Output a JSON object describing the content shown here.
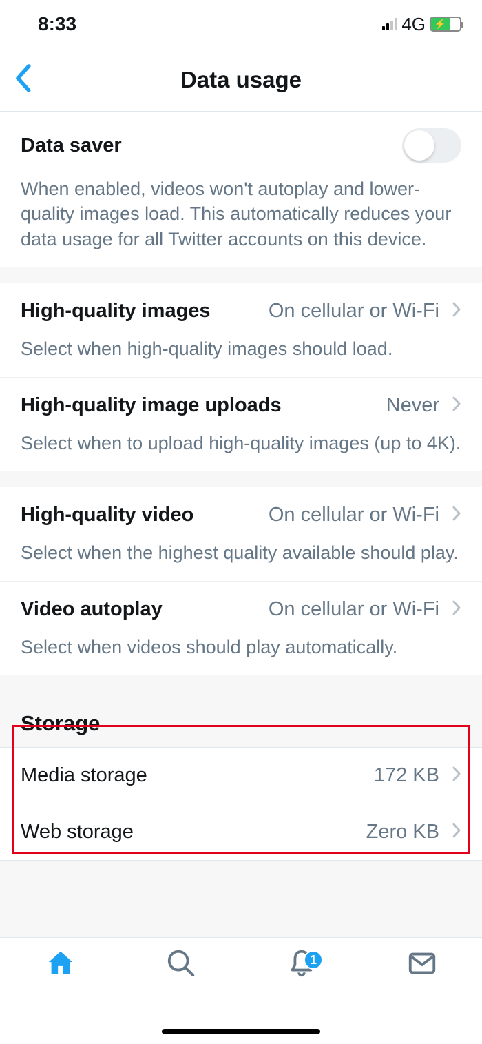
{
  "status": {
    "time": "8:33",
    "network": "4G"
  },
  "header": {
    "title": "Data usage"
  },
  "dataSaver": {
    "title": "Data saver",
    "desc": "When enabled, videos won't autoplay and lower-quality images load. This automatically reduces your data usage for all Twitter accounts on this device."
  },
  "settings": [
    {
      "title": "High-quality images",
      "value": "On cellular or Wi-Fi",
      "desc": "Select when high-quality images should load."
    },
    {
      "title": "High-quality image uploads",
      "value": "Never",
      "desc": "Select when to upload high-quality images (up to 4K)."
    }
  ],
  "video": [
    {
      "title": "High-quality video",
      "value": "On cellular or Wi-Fi",
      "desc": "Select when the highest quality available should play."
    },
    {
      "title": "Video autoplay",
      "value": "On cellular or Wi-Fi",
      "desc": "Select when videos should play automatically."
    }
  ],
  "storage": {
    "heading": "Storage",
    "items": [
      {
        "title": "Media storage",
        "value": "172 KB"
      },
      {
        "title": "Web storage",
        "value": "Zero KB"
      }
    ]
  },
  "tabbar": {
    "badge": "1"
  }
}
